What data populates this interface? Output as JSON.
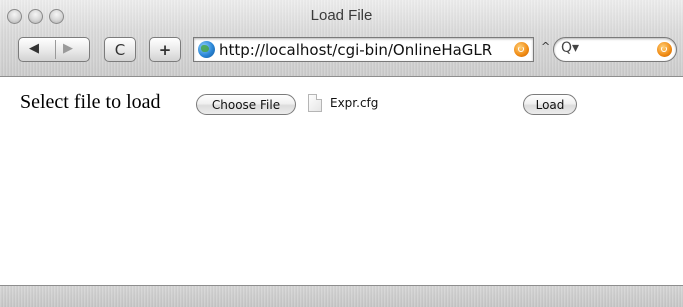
{
  "window": {
    "title": "Load File"
  },
  "toolbar": {
    "back_glyph": "◀",
    "forward_glyph": "▶",
    "reload_glyph": "C",
    "add_glyph": "+",
    "url": "http://localhost/cgi-bin/OnlineHaGLR",
    "search_placeholder": "Q▾",
    "icons": {
      "address": "globe-icon",
      "snapback": "snapback-icon",
      "search": "magnifier-icon",
      "search_snapback": "snapback-icon"
    }
  },
  "form": {
    "label": "Select file to load",
    "choose_button_label": "Choose File",
    "selected_file": "Expr.cfg",
    "load_button_label": "Load"
  },
  "colors": {
    "accent_orange": "#f08a12",
    "globe_blue": "#2b86d6"
  }
}
